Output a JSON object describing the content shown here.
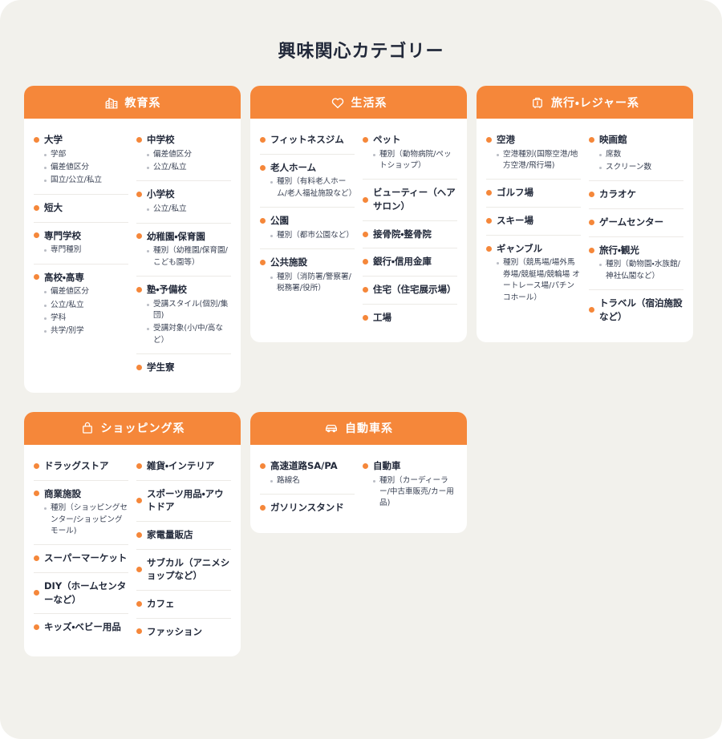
{
  "page": {
    "title": "興味関心カテゴリー",
    "accent_color": "#f5873a",
    "background_color": "#f2f1ec",
    "card_background": "#ffffff",
    "title_color": "#22293a"
  },
  "cards": [
    {
      "id": "education",
      "header_label": "教育系",
      "header_icon": "school-building-icon",
      "columns": [
        {
          "groups": [
            {
              "title": "大学",
              "subs": [
                "学部",
                "偏差値区分",
                "国立/公立/私立"
              ]
            },
            {
              "title": "短大",
              "subs": []
            },
            {
              "title": "専門学校",
              "subs": [
                "専門種別"
              ]
            },
            {
              "title": "高校・高専",
              "subs": [
                "偏差値区分",
                "公立/私立",
                "学科",
                "共学/別学"
              ]
            }
          ]
        },
        {
          "groups": [
            {
              "title": "中学校",
              "subs": [
                "偏差値区分",
                "公立/私立"
              ]
            },
            {
              "title": "小学校",
              "subs": [
                "公立/私立"
              ]
            },
            {
              "title": "幼稚園・保育園",
              "subs": [
                "種別（幼稚園/保育園/こども園等）"
              ]
            },
            {
              "title": "塾・予備校",
              "subs": [
                "受講スタイル(個別/集団)",
                "受講対象(小/中/高など）"
              ]
            },
            {
              "title": "学生寮",
              "subs": []
            }
          ]
        }
      ]
    },
    {
      "id": "life",
      "header_label": "生活系",
      "header_icon": "heart-icon",
      "columns": [
        {
          "groups": [
            {
              "title": "フィットネスジム",
              "subs": []
            },
            {
              "title": "老人ホーム",
              "subs": [
                "種別（有料老人ホーム/老人福祉施設など）"
              ]
            },
            {
              "title": "公園",
              "subs": [
                "種別（都市公園など）"
              ]
            },
            {
              "title": "公共施設",
              "subs": [
                "種別（消防署/警察署/税務署/役所）"
              ]
            }
          ]
        },
        {
          "groups": [
            {
              "title": "ペット",
              "subs": [
                "種別（動物病院/ペットショップ）"
              ]
            },
            {
              "title": "ビューティー（ヘアサロン）",
              "subs": []
            },
            {
              "title": "接骨院・整骨院",
              "subs": []
            },
            {
              "title": "銀行・信用金庫",
              "subs": []
            },
            {
              "title": "住宅（住宅展示場）",
              "subs": []
            },
            {
              "title": "工場",
              "subs": []
            }
          ]
        }
      ]
    },
    {
      "id": "travel",
      "header_label": "旅行・レジャー系",
      "header_icon": "suitcase-icon",
      "columns": [
        {
          "groups": [
            {
              "title": "空港",
              "subs": [
                "空港種別(国際空港/地方空港/飛行場)"
              ]
            },
            {
              "title": "ゴルフ場",
              "subs": []
            },
            {
              "title": "スキー場",
              "subs": []
            },
            {
              "title": "ギャンブル",
              "subs": [
                "種別（競馬場/場外馬券場/競艇場/競輪場 オートレース場/パチンコホール）"
              ]
            }
          ]
        },
        {
          "groups": [
            {
              "title": "映画館",
              "subs": [
                "席数",
                "スクリーン数"
              ]
            },
            {
              "title": "カラオケ",
              "subs": []
            },
            {
              "title": "ゲームセンター",
              "subs": []
            },
            {
              "title": "旅行・観光",
              "subs": [
                "種別（動物園・水族館/神社仏閣など）"
              ]
            },
            {
              "title": "トラベル（宿泊施設など）",
              "subs": []
            }
          ]
        }
      ]
    },
    {
      "id": "shopping",
      "header_label": "ショッピング系",
      "header_icon": "shopping-bag-icon",
      "columns": [
        {
          "groups": [
            {
              "title": "ドラッグストア",
              "subs": []
            },
            {
              "title": "商業施設",
              "subs": [
                "種別（ショッピングセンター/ショッピングモール)"
              ]
            },
            {
              "title": "スーパーマーケット",
              "subs": []
            },
            {
              "title": "DIY（ホームセンターなど）",
              "subs": []
            },
            {
              "title": "キッズ・ベビー用品",
              "subs": []
            }
          ]
        },
        {
          "groups": [
            {
              "title": "雑貨・インテリア",
              "subs": []
            },
            {
              "title": "スポーツ用品・アウトドア",
              "subs": []
            },
            {
              "title": "家電量販店",
              "subs": []
            },
            {
              "title": "サブカル（アニメショップなど）",
              "subs": []
            },
            {
              "title": "カフェ",
              "subs": []
            },
            {
              "title": "ファッション",
              "subs": []
            }
          ]
        }
      ]
    },
    {
      "id": "automotive",
      "header_label": "自動車系",
      "header_icon": "car-icon",
      "columns": [
        {
          "groups": [
            {
              "title": "高速道路SA/PA",
              "subs": [
                "路線名"
              ]
            },
            {
              "title": "ガソリンスタンド",
              "subs": []
            }
          ]
        },
        {
          "groups": [
            {
              "title": "自動車",
              "subs": [
                "種別（カーディーラー/中古車販売/カー用品)"
              ]
            }
          ]
        }
      ]
    }
  ]
}
